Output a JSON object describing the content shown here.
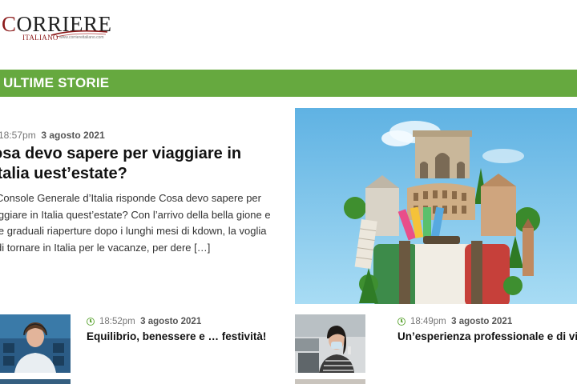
{
  "header": {
    "logo_main": "CORRIERE",
    "logo_sub": "ITALIANO",
    "logo_url": "www.corriereitaliano.com"
  },
  "section": {
    "title": "ULTIME STORIE"
  },
  "featured": {
    "time": "18:57pm",
    "date": "3 agosto 2021",
    "title": "osa devo sapere per viaggiare in Italia uest’estate?",
    "excerpt": "Console Generale d’Italia risponde   Cosa devo sapere per iggiare in Italia quest’estate? Con l’arrivo della bella gione e le graduali riaperture dopo i lunghi mesi di kdown, la voglia di tornare in Italia per le vacanze, per dere […]",
    "image": "italy-landmarks-suitcase-image"
  },
  "cards": [
    {
      "time": "18:52pm",
      "date": "3 agosto 2021",
      "title": "Equilibrio, benessere e … festività!",
      "image": "woman-with-headset-image"
    },
    {
      "time": "18:49pm",
      "date": "3 agosto 2021",
      "title": "Un’esperienza professionale e di vita",
      "image": "woman-with-mask-image"
    }
  ],
  "colors": {
    "accent_green": "#66a93f",
    "logo_red": "#8b1a1a",
    "sky_blue": "#7cc4ea"
  }
}
